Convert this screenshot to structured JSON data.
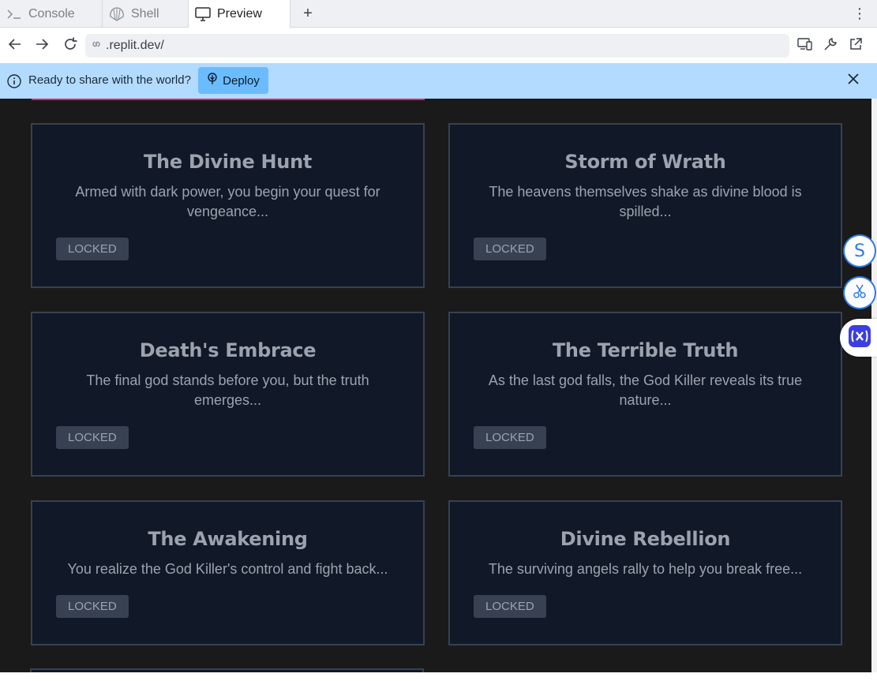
{
  "tabs": [
    {
      "label": "Console",
      "icon": "terminal-icon",
      "active": false
    },
    {
      "label": "Shell",
      "icon": "shell-icon",
      "active": false
    },
    {
      "label": "Preview",
      "icon": "monitor-icon",
      "active": true
    }
  ],
  "tab_add_label": "+",
  "tab_more_label": "⋮",
  "address": {
    "url": ".replit.dev/"
  },
  "banner": {
    "message": "Ready to share with the world?",
    "deploy_label": "Deploy"
  },
  "chapters": [
    {
      "title": "The Divine Hunt",
      "description": "Armed with dark power, you begin your quest for vengeance...",
      "status": "LOCKED"
    },
    {
      "title": "Storm of Wrath",
      "description": "The heavens themselves shake as divine blood is spilled...",
      "status": "LOCKED"
    },
    {
      "title": "Death's Embrace",
      "description": "The final god stands before you, but the truth emerges...",
      "status": "LOCKED"
    },
    {
      "title": "The Terrible Truth",
      "description": "As the last god falls, the God Killer reveals its true nature...",
      "status": "LOCKED"
    },
    {
      "title": "The Awakening",
      "description": "You realize the God Killer's control and fight back...",
      "status": "LOCKED"
    },
    {
      "title": "Divine Rebellion",
      "description": "The surviving angels rally to help you break free...",
      "status": "LOCKED"
    }
  ],
  "side_widgets": {
    "s_label": "S"
  },
  "colors": {
    "banner_bg": "#b3dbff",
    "deploy_bg": "#6bbcff",
    "page_bg": "#1a1a1a",
    "card_bg": "#111827",
    "card_border": "#374151",
    "text_muted": "#9ca3af",
    "accent": "#e0245e"
  }
}
